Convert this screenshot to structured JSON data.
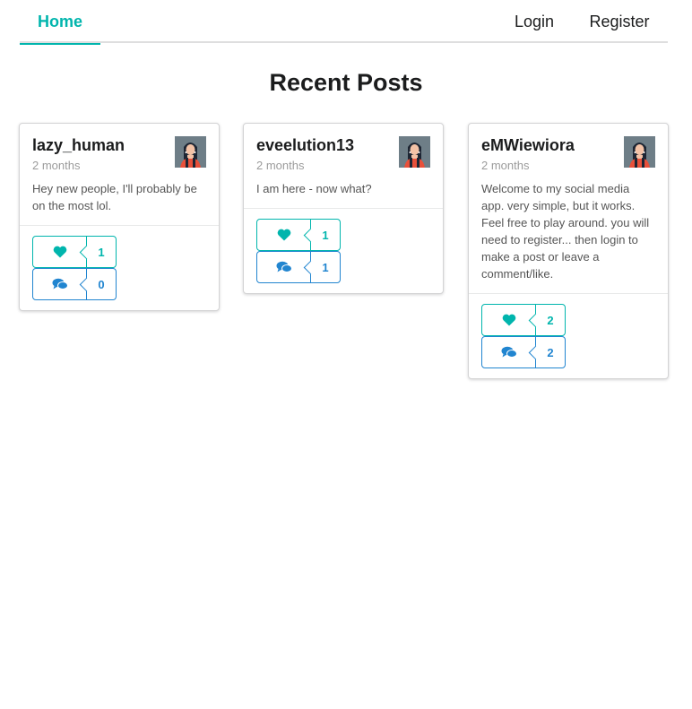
{
  "nav": {
    "home": "Home",
    "login": "Login",
    "register": "Register"
  },
  "page_title": "Recent Posts",
  "colors": {
    "accent": "#00b5ad",
    "blue": "#2185d0"
  },
  "posts": [
    {
      "user": "lazy_human",
      "time": "2 months",
      "body": "Hey new people, I'll probably be on the most lol.",
      "likes": "1",
      "comments": "0"
    },
    {
      "user": "eveelution13",
      "time": "2 months",
      "body": "I am here - now what?",
      "likes": "1",
      "comments": "1"
    },
    {
      "user": "eMWiewiora",
      "time": "2 months",
      "body": "Welcome to my social media app. very simple, but it works. Feel free to play around. you will need to register... then login to make a post or leave a comment/like.",
      "likes": "2",
      "comments": "2"
    }
  ]
}
